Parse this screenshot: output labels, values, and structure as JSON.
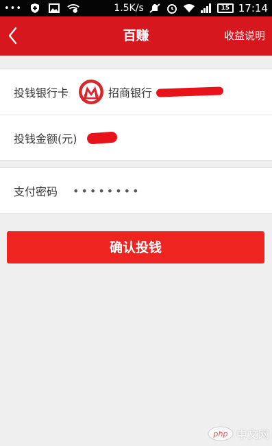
{
  "status_bar": {
    "dots": "•••",
    "speed": "1.5K/s",
    "battery": "15",
    "time": "17:14"
  },
  "header": {
    "title": "百赚",
    "right_link": "收益说明"
  },
  "form": {
    "bank_card_label": "投钱银行卡",
    "bank_name": "招商银行",
    "amount_label": "投钱金额(元)",
    "password_label": "支付密码",
    "password_value": "••••••••"
  },
  "confirm_button": "确认投钱",
  "watermark": {
    "logo_text": "php",
    "text": "中文网"
  },
  "colors": {
    "header_bg": "#d6171d",
    "button_bg": "#ee2420",
    "redaction": "#e8121b"
  },
  "icons": [
    "shield-icon",
    "image-icon",
    "wifi-icon",
    "mute-icon",
    "alarm-icon",
    "signal-icon",
    "battery-icon",
    "back-chevron-icon",
    "bank-logo-icon"
  ]
}
